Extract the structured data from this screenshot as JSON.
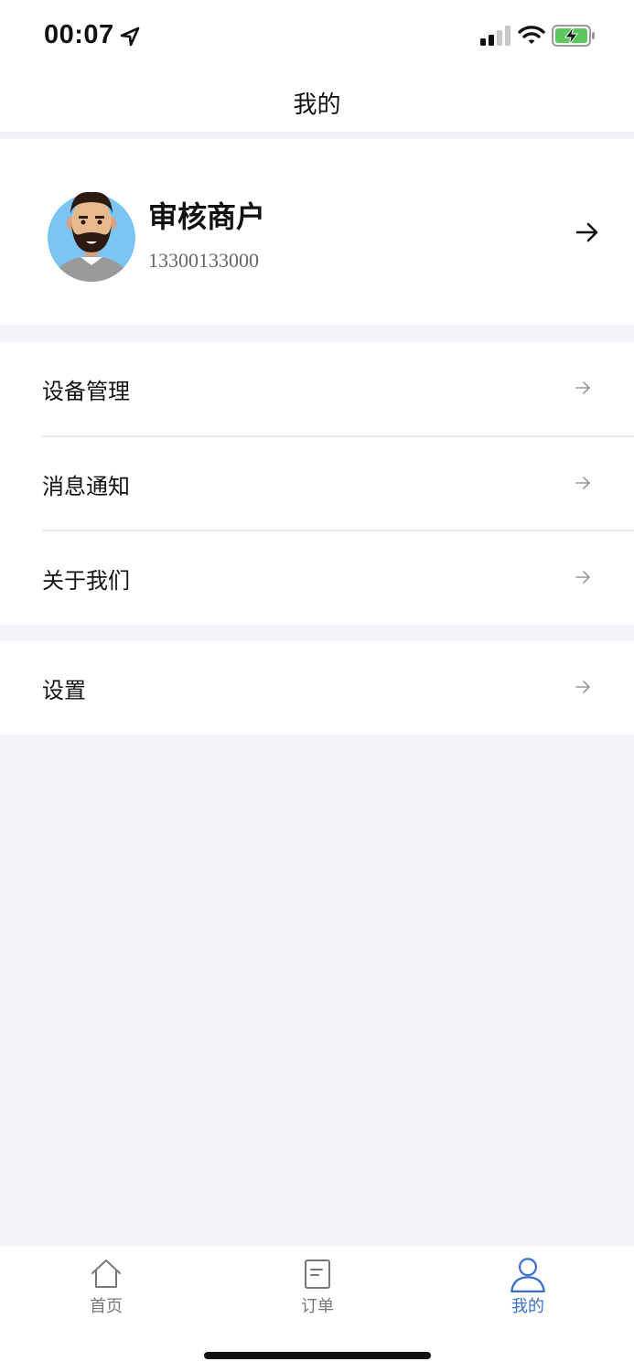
{
  "status_bar": {
    "time": "00:07",
    "icons": [
      "location-arrow-icon",
      "signal-icon",
      "wifi-icon",
      "battery-charging-icon"
    ],
    "battery_color": "#5ac85a"
  },
  "navbar": {
    "title": "我的"
  },
  "profile": {
    "name": "审核商户",
    "phone": "13300133000",
    "avatar_icon": "avatar-bearded-man",
    "avatar_bg": "#7cc4f4"
  },
  "menu": {
    "group1": [
      {
        "label": "设备管理",
        "icon": "arrow-right-icon"
      },
      {
        "label": "消息通知",
        "icon": "arrow-right-icon"
      },
      {
        "label": "关于我们",
        "icon": "arrow-right-icon"
      }
    ],
    "group2": [
      {
        "label": "设置",
        "icon": "arrow-right-icon"
      }
    ]
  },
  "tabbar": {
    "tabs": [
      {
        "label": "首页",
        "icon": "home-icon",
        "active": false
      },
      {
        "label": "订单",
        "icon": "document-icon",
        "active": false
      },
      {
        "label": "我的",
        "icon": "user-icon",
        "active": true
      }
    ],
    "active_color": "#3a6fd0",
    "inactive_color": "#777777"
  },
  "colors": {
    "background": "#f4f5f9",
    "surface": "#ffffff"
  }
}
